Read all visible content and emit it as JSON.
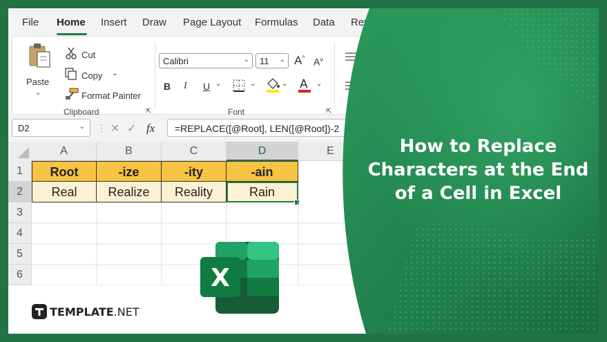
{
  "menu": {
    "tabs": [
      "File",
      "Home",
      "Insert",
      "Draw",
      "Page Layout",
      "Formulas",
      "Data",
      "Revi"
    ],
    "active": "Home"
  },
  "clipboard": {
    "paste": "Paste",
    "cut": "Cut",
    "copy": "Copy",
    "format_painter": "Format Painter",
    "group": "Clipboard"
  },
  "font": {
    "family": "Calibri",
    "size": "11",
    "group": "Font",
    "bold": "B",
    "italic": "I",
    "underline": "U",
    "grow": "A",
    "shrink": "A"
  },
  "formula_bar": {
    "name_box": "D2",
    "fx": "fx",
    "formula": "=REPLACE([@Root], LEN([@Root])-2"
  },
  "sheet": {
    "columns": [
      "A",
      "B",
      "C",
      "D",
      "E"
    ],
    "rows": [
      "1",
      "2",
      "3",
      "4",
      "5",
      "6"
    ],
    "header_row": [
      "Root",
      "-ize",
      "-ity",
      "-ain"
    ],
    "data_row": [
      "Real",
      "Realize",
      "Reality",
      "Rain"
    ]
  },
  "banner": {
    "line1": "How to Replace",
    "line2": "Characters at the End",
    "line3": "of a Cell in Excel"
  },
  "brand": {
    "name_bold": "TEMPLATE",
    "name_light": ".NET"
  },
  "colors": {
    "excel_green": "#217346",
    "header_fill": "#f6c342",
    "value_fill": "#fdf1d3"
  }
}
